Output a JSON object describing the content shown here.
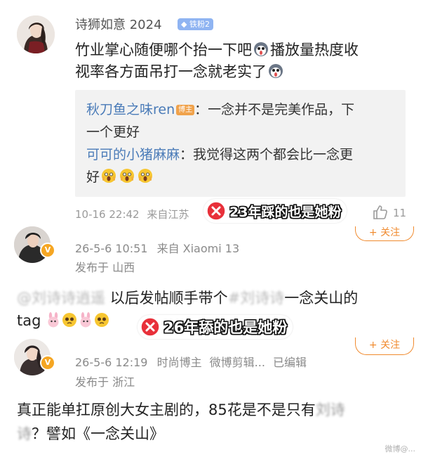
{
  "comment1": {
    "username": "诗狮如意 2024",
    "fan_badge": "铁粉2",
    "body_line1": "竹业掌心随便哪个抬一下吧",
    "body_line1b": "播放量热度收",
    "body_line2": "视率各方面吊打一念就老实了",
    "replies": [
      {
        "user": "秋刀鱼之味ren",
        "badge": "博主",
        "text_line1": "：一念并不是完美作品，下",
        "text_line2": "一个更好"
      },
      {
        "user": "可可的小猪麻麻",
        "text_line1": "：我觉得这两个都会比一念更",
        "text_line2": "好"
      }
    ],
    "time": "10-16 22:42",
    "location": "来自江苏",
    "like_count": "11",
    "like_icon": "thumbs-up-icon"
  },
  "annotation1": {
    "text": "23年踩的也是她粉",
    "icon": "red-x-circle-icon"
  },
  "comment2": {
    "time": "26-5-6 10:51",
    "source": "来自 Xiaomi 13",
    "location": "发布于 山西",
    "follow_label": "+ 关注",
    "blurred_name1": "@刘诗诗逍遥",
    "body_text": "以后发帖顺手带个",
    "blurred_name2": "#刘诗诗",
    "body_text2": "一念关山的",
    "body_line2": "tag"
  },
  "annotation2": {
    "text": "26年舔的也是她粉",
    "icon": "red-x-circle-icon"
  },
  "comment3": {
    "time": "26-5-6 12:19",
    "role": "时尚博主",
    "tag": "微博剪辑...",
    "edited": "已编辑",
    "location": "发布于 浙江",
    "follow_label": "+ 关注",
    "body_line1": "真正能单扛原创大女主剧的，85花是不是只有",
    "blurred_name1": "刘诗",
    "blurred_name2": "诗",
    "body_line2": "？譬如《一念关山》"
  },
  "watermark": "微博@...",
  "colors": {
    "link_blue": "#4a7bb8",
    "meta_gray": "#9a9a9a",
    "follow_orange": "#f08a2e",
    "annotation_red": "#e8303a"
  }
}
